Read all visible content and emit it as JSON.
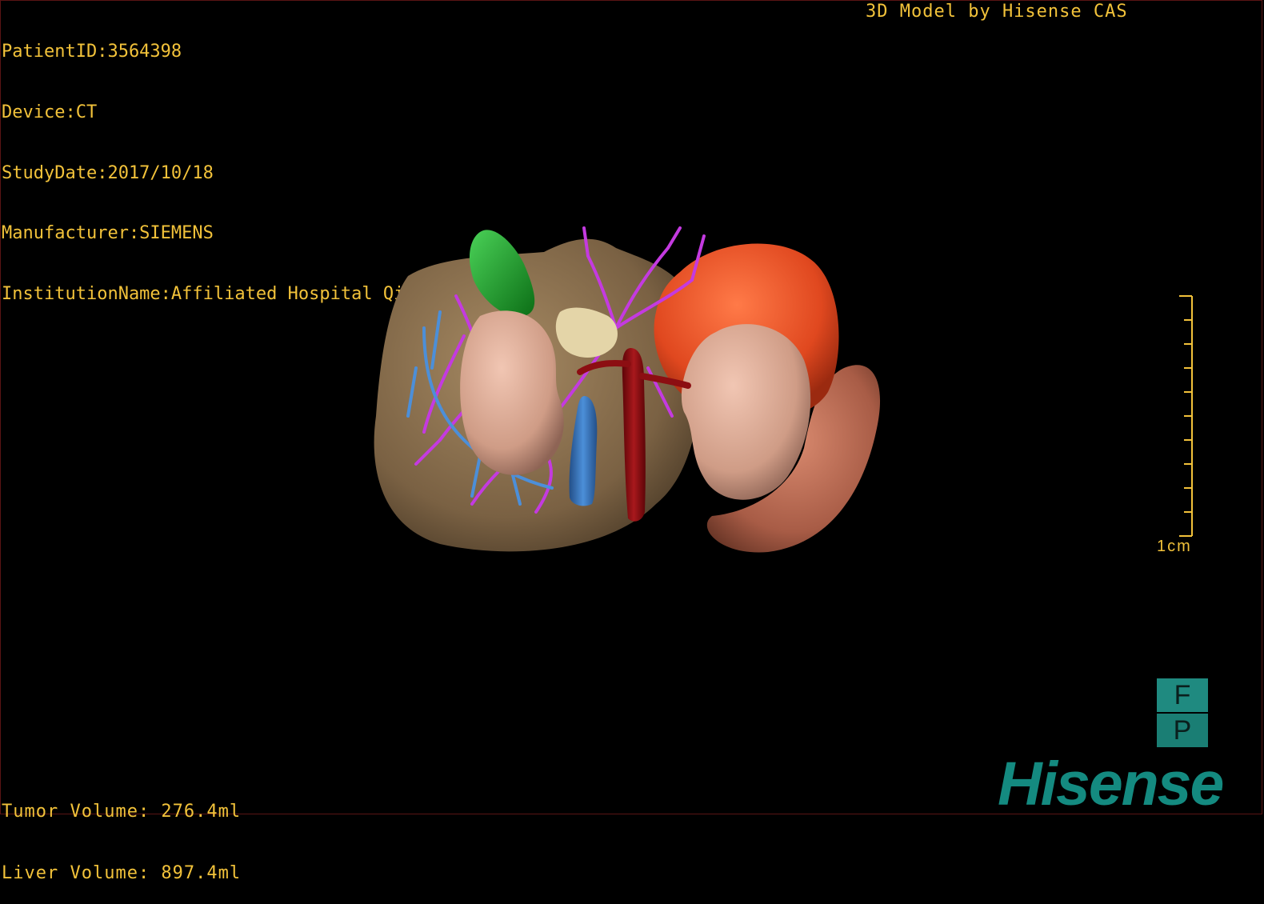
{
  "header": {
    "patient_id": "PatientID:3564398",
    "device": "Device:CT",
    "study_date": "StudyDate:2017/10/18",
    "manufacturer": "Manufacturer:SIEMENS",
    "institution": "InstitutionName:Affiliated Hospital Qingdao University-C",
    "credit": "3D Model by Hisense CAS"
  },
  "volumes": {
    "tumor": "Tumor Volume: 276.4ml",
    "liver": "Liver Volume: 897.4ml"
  },
  "scale": {
    "label": "1cm",
    "tick_count": 11
  },
  "orientation": {
    "top": "F",
    "bottom": "P"
  },
  "logo": {
    "text": "Hisense"
  },
  "colors": {
    "overlay_text": "#f2c23a",
    "liver": "#8a6f4e",
    "tumor": "#e8542a",
    "kidney": "#d9a691",
    "gallbladder": "#1f9a2a",
    "aorta": "#8c0e12",
    "ivc": "#3a7ec9",
    "portal_vein": "#c43ae0",
    "spine_bone": "#e4d5a8",
    "spleen": "#b86b55",
    "logo": "#148a80"
  }
}
